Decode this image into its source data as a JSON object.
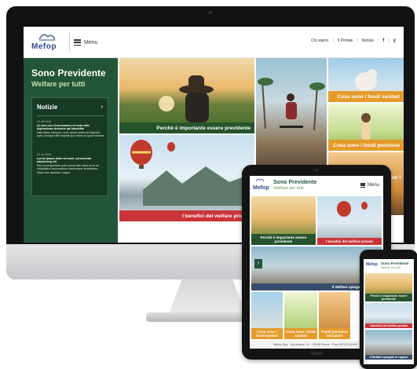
{
  "brand": {
    "logo_text": "Mefop"
  },
  "header": {
    "menu_label": "Menu",
    "nav": [
      "Chi siamo",
      "Il Portale",
      "Notizie"
    ],
    "social": [
      "f",
      "y"
    ]
  },
  "hero": {
    "title": "Sono Previdente",
    "subtitle": "Welfare per tutti"
  },
  "news": {
    "heading": "Notizie",
    "items": [
      {
        "date": "13 ott 2016",
        "title": "At vero eos et accusamus et iusto odio dignissimos ducimus qui blanditiis",
        "body": "Nam libero tempore, cum soluta nobis est eligendi optio cumque nihil impedit quo minus id quod maxime"
      },
      {
        "date": "12 ott 2016",
        "title": "Lorem ipsum dolor sit amet, consectetur adipisicing elit",
        "body": "Sed ut perspiciatis unde omnis iste natus error sit voluptatem accusantium doloremque laudantium, totam rem aperiam, eaque"
      }
    ]
  },
  "tiles": {
    "important": "Perché è importante essere previdente",
    "benefits": "I benefici del welfare privato",
    "health_funds": "Cosa sono i fondi sanitari",
    "pension_funds": "Cosa sono i fondi pensione",
    "side": "zioni ?"
  },
  "tablet": {
    "title": "Sono Previdente",
    "subtitle": "Welfare per tutti",
    "menu_label": "Menu",
    "tiles": {
      "important": "Perché è importante essere previdente",
      "benefits": "I benefici del welfare privato",
      "explained": "Il Welfare spiegato ai ragazzi",
      "a": "Cosa sono i fondi sanitari",
      "b": "Cosa sono i fondi sanitari",
      "c": "Fondi pensione istruzioni"
    },
    "footer": "Mefop Spa · Via Aniene, 14 · 00198 Roma · P.iva 05722101009"
  },
  "phone": {
    "title": "Sono Previdente",
    "subtitle": "Welfare per tutti",
    "tiles": {
      "important": "Perché è importante essere previdente",
      "benefits": "I benefici del welfare privato",
      "explained": "Il Welfare spiegato ai ragazzi"
    }
  },
  "colors": {
    "primary": "#23553a",
    "accent_red": "#c93438",
    "accent_orange": "#e59a2a",
    "brand_blue": "#2c4a8a"
  }
}
